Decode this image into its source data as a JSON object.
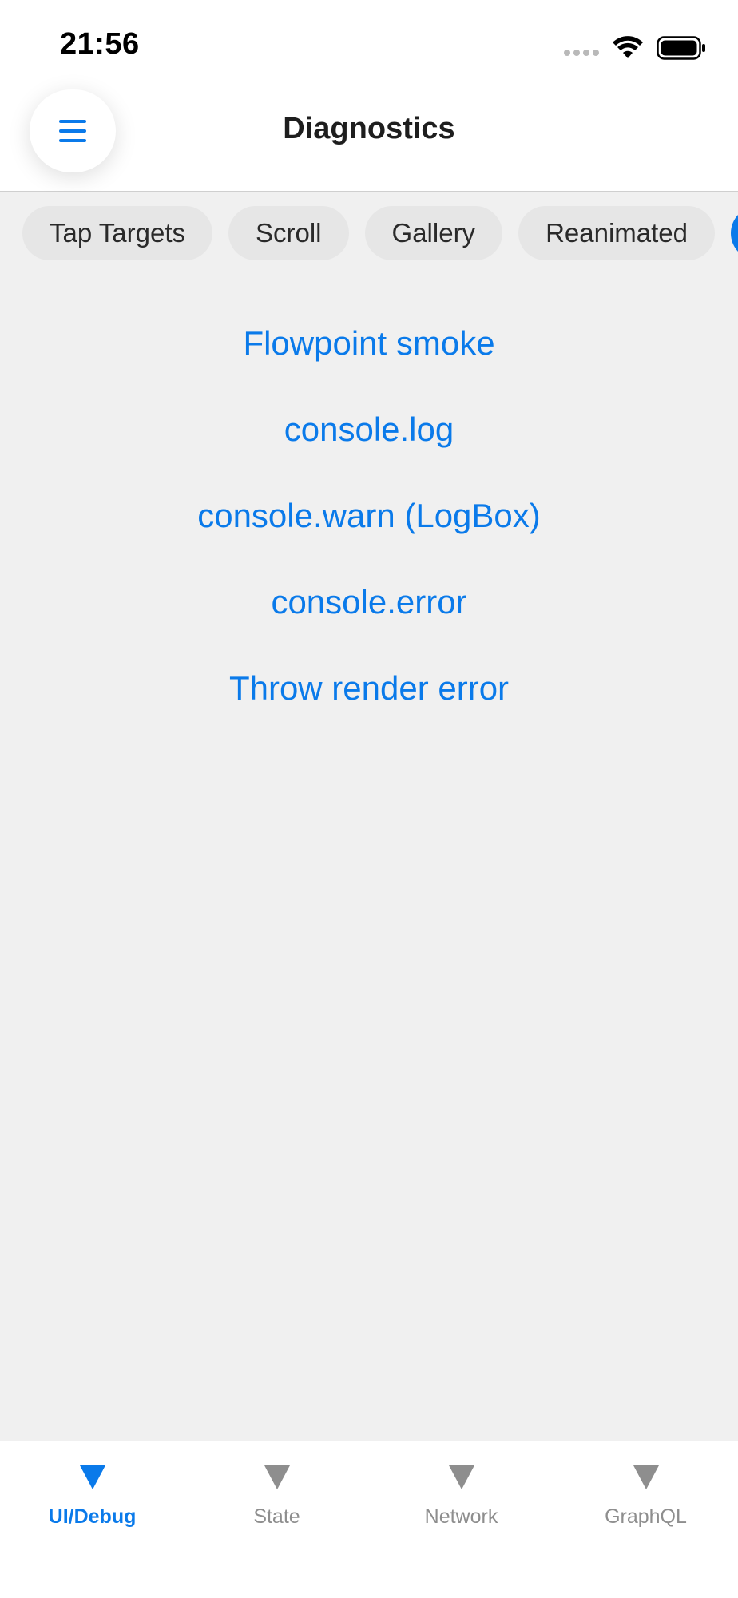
{
  "status_bar": {
    "time": "21:56"
  },
  "header": {
    "title": "Diagnostics",
    "menu_icon": "hamburger-menu-icon"
  },
  "chips": [
    {
      "label": "Tap Targets"
    },
    {
      "label": "Scroll"
    },
    {
      "label": "Gallery"
    },
    {
      "label": "Reanimated"
    },
    {
      "label": ""
    }
  ],
  "actions": [
    {
      "label": "Flowpoint smoke"
    },
    {
      "label": "console.log"
    },
    {
      "label": "console.warn (LogBox)"
    },
    {
      "label": "console.error"
    },
    {
      "label": "Throw render error"
    }
  ],
  "tabs": [
    {
      "label": "UI/Debug",
      "active": true
    },
    {
      "label": "State",
      "active": false
    },
    {
      "label": "Network",
      "active": false
    },
    {
      "label": "GraphQL",
      "active": false
    }
  ],
  "colors": {
    "accent": "#0a7aea",
    "inactive": "#8e8e8e",
    "background": "#f0f0f0"
  }
}
